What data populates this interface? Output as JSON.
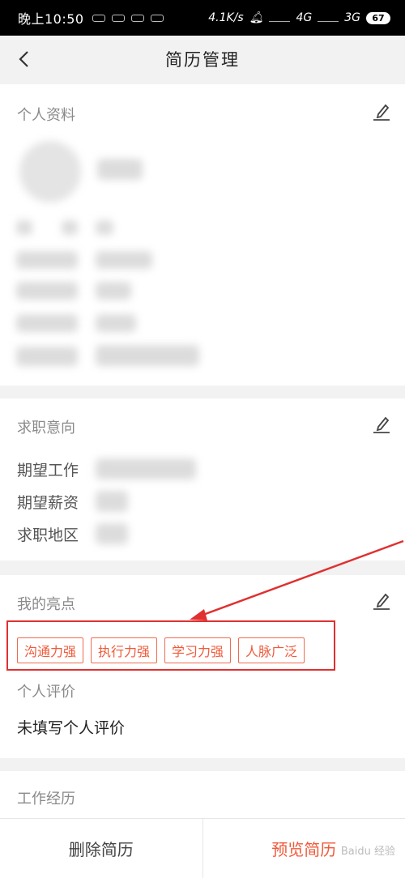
{
  "status_bar": {
    "time": "晚上10:50",
    "network_speed": "4.1K/s",
    "signal_1": "4G",
    "signal_2": "3G",
    "battery": "67"
  },
  "nav": {
    "title": "简历管理"
  },
  "profile": {
    "section_title": "个人资料"
  },
  "job_intent": {
    "section_title": "求职意向",
    "labels": [
      "期望工作",
      "期望薪资",
      "求职地区"
    ]
  },
  "highlights": {
    "section_title": "我的亮点",
    "tags": [
      "沟通力强",
      "执行力强",
      "学习力强",
      "人脉广泛"
    ]
  },
  "evaluation": {
    "title": "个人评价",
    "value": "未填写个人评价"
  },
  "work": {
    "section_title": "工作经历"
  },
  "footer": {
    "delete_label": "删除简历",
    "preview_label": "预览简历"
  },
  "watermark": "Baidu 经验",
  "colors": {
    "accent": "#f05a3a",
    "annotation": "#e03030"
  }
}
